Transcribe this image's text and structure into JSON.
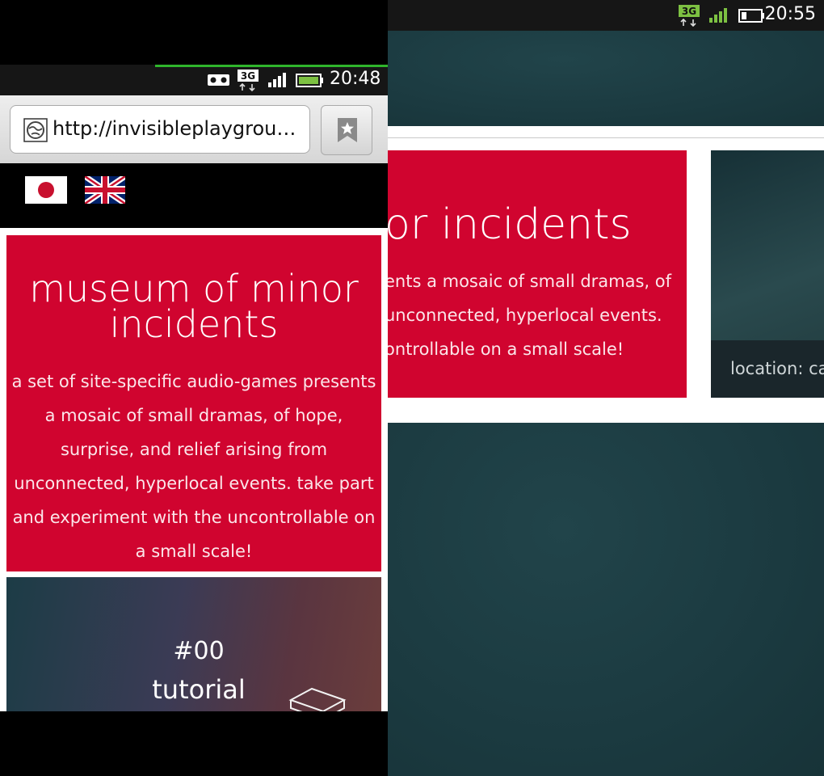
{
  "right_screen": {
    "status_bar": {
      "network": "3G",
      "time": "20:55"
    },
    "card": {
      "title": "or incidents",
      "lines": [
        "ents a mosaic of small dramas, of",
        "unconnected, hyperlocal events.",
        "ontrollable on a small scale!"
      ]
    },
    "tile": {
      "location": "location: car"
    },
    "colors": {
      "accent": "#d0042f",
      "background": "#1b3a40"
    }
  },
  "left_screen": {
    "status_bar": {
      "network": "3G",
      "time": "20:48"
    },
    "browser": {
      "url": "http://invisibleplaygrou…",
      "bookmark_icon": "star-bookmark-icon"
    },
    "flags": [
      "japan-flag",
      "uk-flag"
    ],
    "card": {
      "title": "museum of minor incidents",
      "description": "a set of site-specific audio-games presents a mosaic of small dramas, of hope, surprise, and relief arising from unconnected, hyperlocal events. take part and experiment with the uncontrollable on a small scale!"
    },
    "tile": {
      "number": "#00",
      "name": "tutorial"
    }
  }
}
